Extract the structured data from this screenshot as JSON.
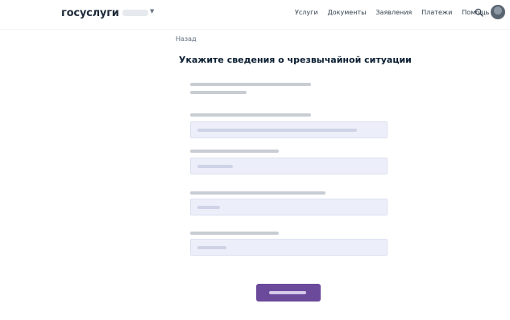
{
  "header": {
    "logo": "госуслуги",
    "nav": [
      "Услуги",
      "Документы",
      "Заявления",
      "Платежи",
      "Помощь"
    ]
  },
  "back": "Назад",
  "title": "Укажите сведения о чрезвычайной ситуации",
  "form": {
    "lead": "",
    "fields": [
      {
        "label": "",
        "value": ""
      },
      {
        "label": "",
        "value": ""
      },
      {
        "label": "",
        "value": ""
      },
      {
        "label": "",
        "value": ""
      }
    ],
    "submit": ""
  },
  "colors": {
    "text": "#0b1f33",
    "field_bg": "#eceef9",
    "button": "#6b4a9c"
  }
}
